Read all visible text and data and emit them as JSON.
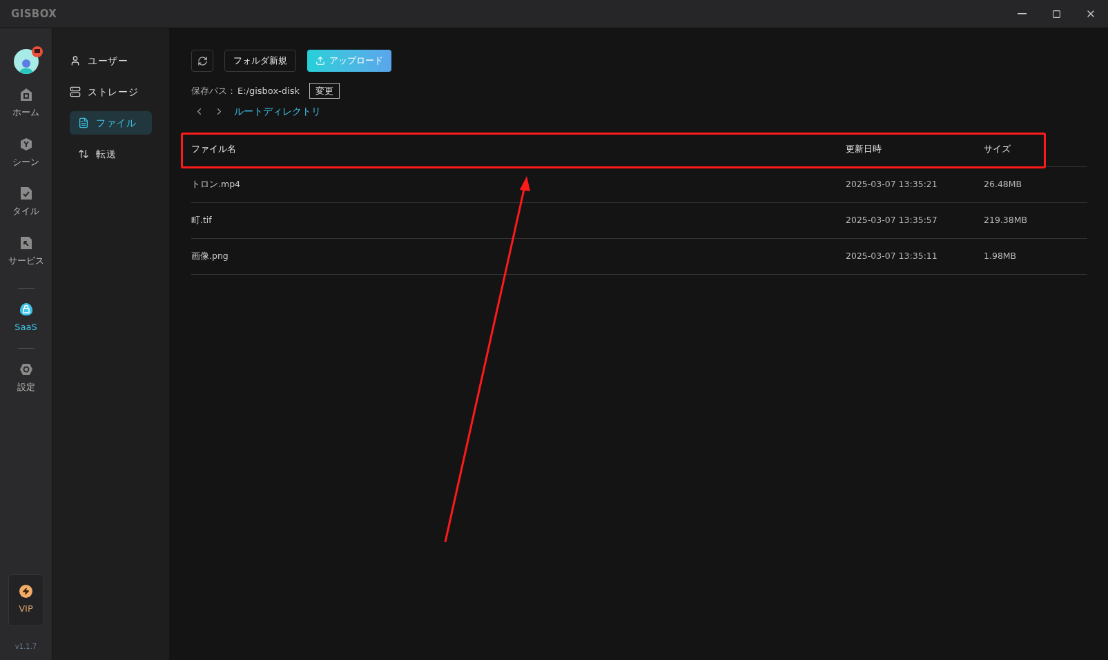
{
  "window": {
    "logo": "GISBOX"
  },
  "rail": {
    "items": [
      {
        "kind": "home",
        "label": "ホーム",
        "selected": false
      },
      {
        "kind": "scene",
        "label": "シーン",
        "selected": false
      },
      {
        "kind": "tile",
        "label": "タイル",
        "selected": false
      },
      {
        "kind": "service",
        "label": "サービス",
        "selected": false
      },
      {
        "kind": "saas",
        "label": "SaaS",
        "selected": true
      },
      {
        "kind": "settings",
        "label": "設定",
        "selected": false
      }
    ],
    "vip": "VIP",
    "version": "v1.1.7"
  },
  "sidebar": {
    "items": [
      {
        "kind": "user",
        "label": "ユーザー",
        "selected": false
      },
      {
        "kind": "storage",
        "label": "ストレージ",
        "selected": false
      },
      {
        "kind": "file",
        "label": "ファイル",
        "selected": true
      },
      {
        "kind": "transfer",
        "label": "転送",
        "selected": false
      }
    ]
  },
  "toolbar": {
    "new_folder": "フォルダ新規",
    "upload": "アップロード"
  },
  "save_path": {
    "label": "保存パス：",
    "value": "E:/gisbox-disk",
    "change": "変更"
  },
  "breadcrumb": "ルートディレクトリ",
  "table": {
    "columns": [
      "ファイル名",
      "更新日時",
      "サイズ"
    ],
    "rows": [
      [
        "トロン.mp4",
        "2025-03-07 13:35:21",
        "26.48MB"
      ],
      [
        "町.tif",
        "2025-03-07 13:35:57",
        "219.38MB"
      ],
      [
        "画像.png",
        "2025-03-07 13:35:11",
        "1.98MB"
      ]
    ]
  }
}
